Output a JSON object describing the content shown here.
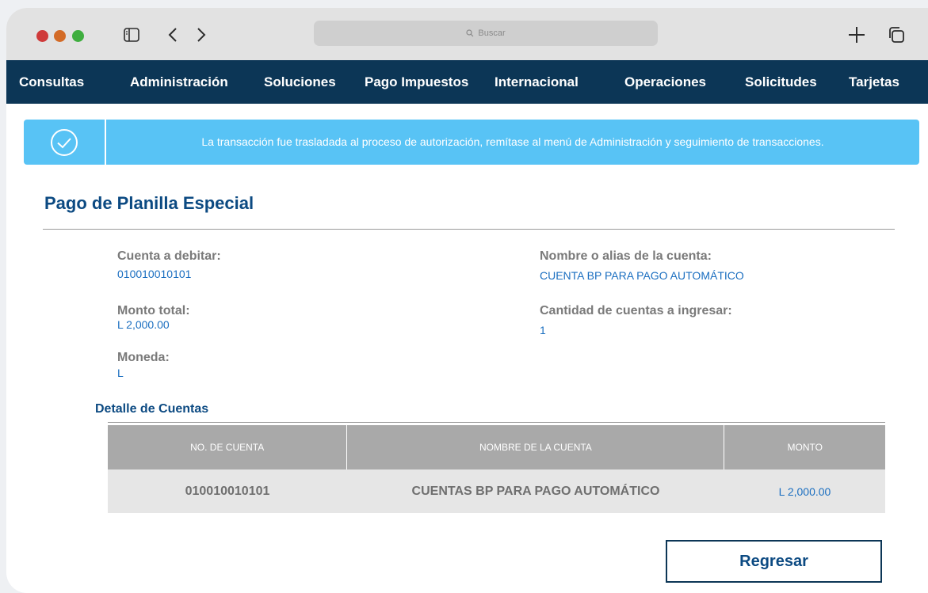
{
  "browser": {
    "search_placeholder": "Buscar"
  },
  "nav": {
    "items": [
      "Consultas",
      "Administración",
      "Soluciones",
      "Pago Impuestos",
      "Internacional",
      "Operaciones",
      "Solicitudes",
      "Tarjetas"
    ]
  },
  "banner": {
    "message": "La transacción fue trasladada al proceso de autorización, remítase al menú de Administración y seguimiento de transacciones."
  },
  "page": {
    "title": "Pago de Planilla Especial"
  },
  "fields": {
    "cuenta_debitar": {
      "label": "Cuenta a debitar:",
      "value": "010010010101"
    },
    "monto_total": {
      "label": "Monto total:",
      "value": "L 2,000.00"
    },
    "moneda": {
      "label": "Moneda:",
      "value": "L"
    },
    "nombre_alias": {
      "label": "Nombre o alias de la cuenta:",
      "value": "CUENTA BP PARA PAGO AUTOMÁTICO"
    },
    "cantidad_cuentas": {
      "label": "Cantidad de cuentas a ingresar:",
      "value": "1"
    }
  },
  "detalle": {
    "title": "Detalle de  Cuentas",
    "columns": [
      "NO. DE CUENTA",
      "NOMBRE DE LA CUENTA",
      "MONTO"
    ],
    "rows": [
      [
        "010010010101",
        "CUENTAS BP PARA PAGO AUTOMÁTICO",
        "L 2,000.00"
      ]
    ]
  },
  "actions": {
    "back_label": "Regresar"
  },
  "colors": {
    "nav_bg": "#0c3656",
    "banner_bg": "#58c3f5",
    "title": "#0c4a82",
    "value": "#1a6ec0"
  }
}
